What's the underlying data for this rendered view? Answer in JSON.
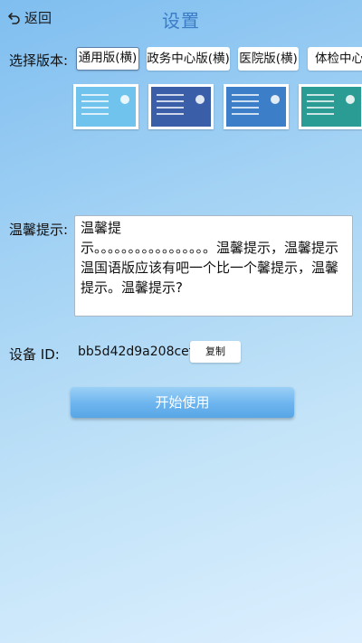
{
  "header": {
    "back_label": "返回",
    "title": "设置"
  },
  "version": {
    "label": "选择版本:",
    "tabs": [
      {
        "label": "通用版(横)",
        "selected": true
      },
      {
        "label": "政务中心版(横)",
        "selected": false
      },
      {
        "label": "医院版(横)",
        "selected": false
      },
      {
        "label": "体检中心",
        "selected": false
      }
    ],
    "thumbnail_colors": [
      "#6fc3ec",
      "#3a5fa8",
      "#3c7fc8",
      "#2a9c94"
    ]
  },
  "tip": {
    "label": "温馨提示:",
    "text": "温馨提\n示。。。。。。。。。。。。。。。。。温馨提示，温馨提示温国语版应该有吧一个比一个馨提示，温馨提示。温馨提示?"
  },
  "device": {
    "label": "设备  ID:",
    "id": "bb5d42d9a208cef",
    "copy_label": "复制"
  },
  "start_button_label": "开始使用"
}
